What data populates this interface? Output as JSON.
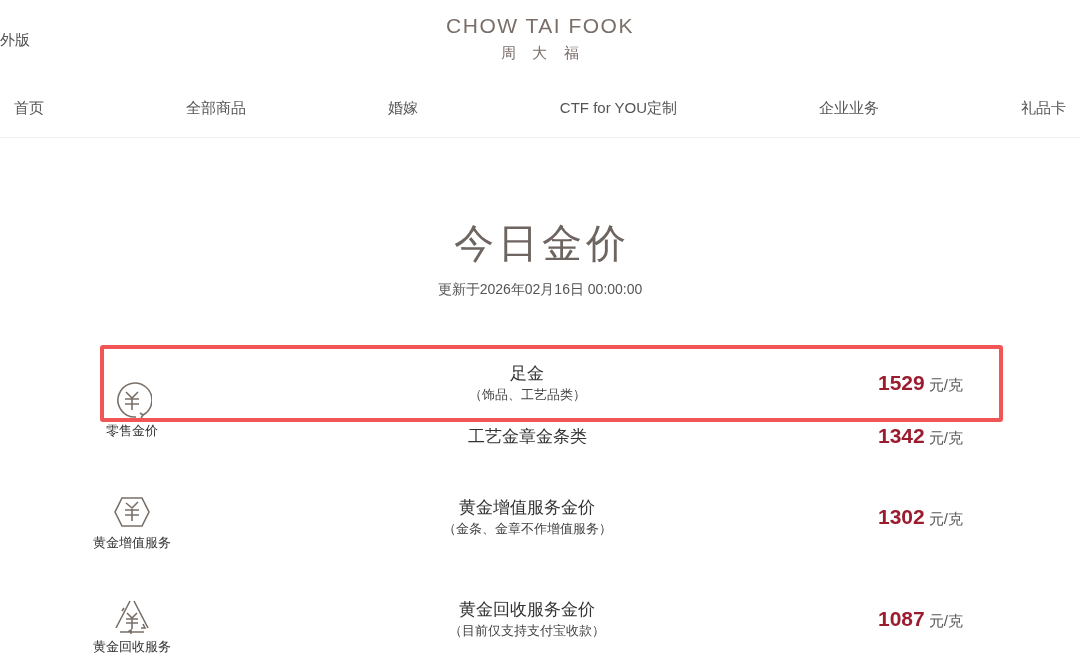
{
  "header": {
    "region_link": "外版",
    "logo_en": "CHOW TAI FOOK",
    "logo_zh": "周 大 福"
  },
  "nav": [
    "首页",
    "全部商品",
    "婚嫁",
    "CTF for YOU定制",
    "企业业务",
    "礼品卡"
  ],
  "page_title": "今日金价",
  "updated": "更新于2026年02月16日 00:00:00",
  "rows": [
    {
      "kind": "circle",
      "icon_label": "零售金价",
      "name": "足金",
      "note": "（饰品、工艺品类）",
      "price": "1529",
      "unit": "元/克",
      "highlighted": true
    },
    {
      "name": "工艺金章金条类",
      "price": "1342",
      "unit": "元/克",
      "highlighted": false
    },
    {
      "kind": "diamond",
      "icon_label": "黄金增值服务",
      "name": "黄金增值服务金价",
      "note": "（金条、金章不作增值服务）",
      "price": "1302",
      "unit": "元/克",
      "highlighted": false
    },
    {
      "kind": "recycle",
      "icon_label": "黄金回收服务",
      "name": "黄金回收服务金价",
      "note": "（目前仅支持支付宝收款）",
      "price": "1087",
      "unit": "元/克",
      "highlighted": false
    }
  ]
}
